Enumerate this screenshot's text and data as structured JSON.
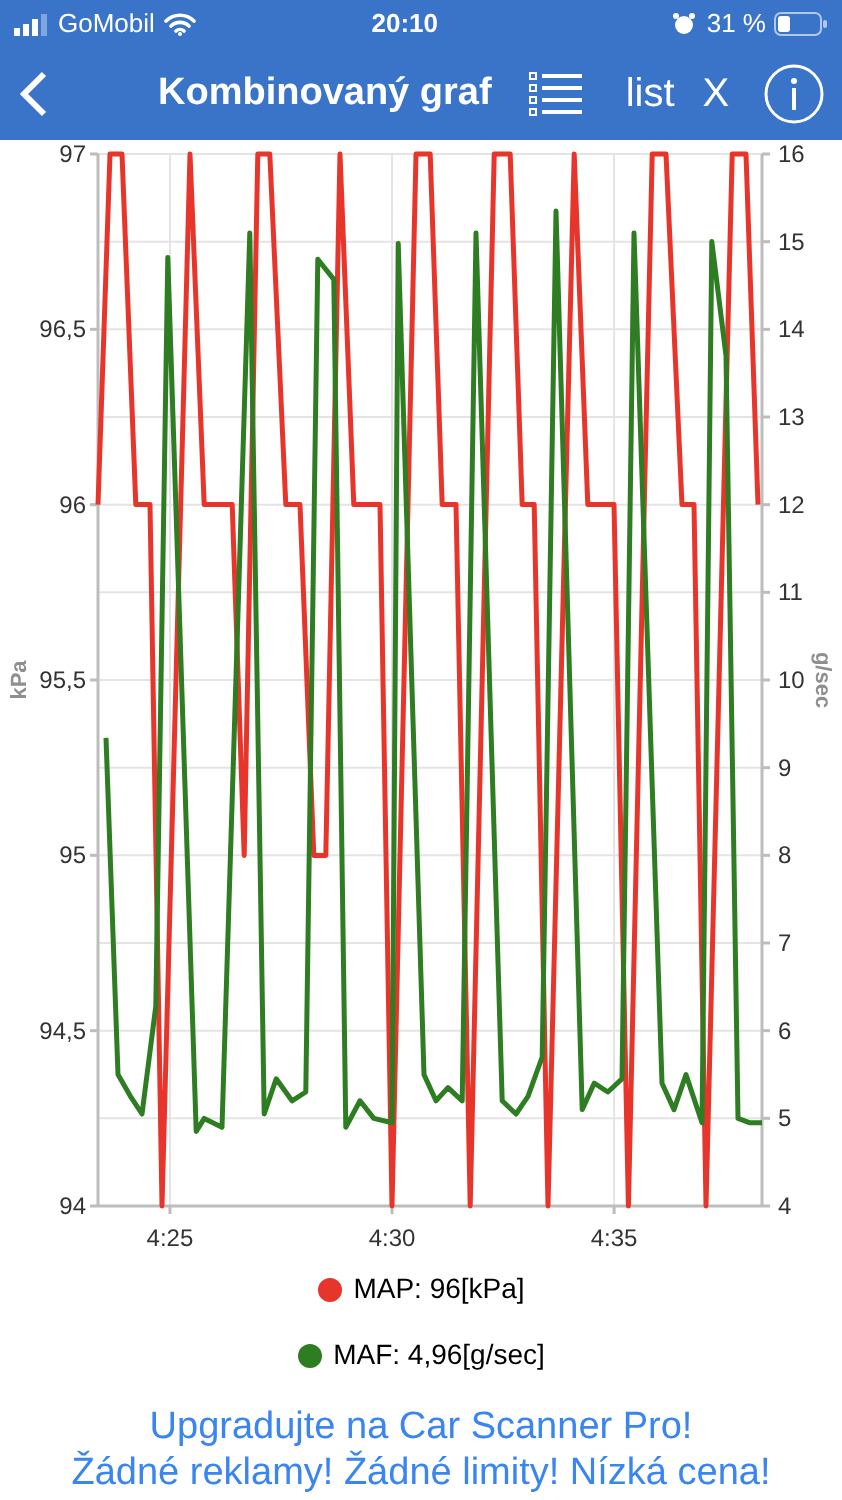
{
  "status_bar": {
    "carrier": "GoMobil",
    "time": "20:10",
    "battery": "31 %"
  },
  "nav": {
    "title": "Kombinovaný graf",
    "list_label": "list",
    "close_label": "X"
  },
  "chart_data": {
    "type": "line",
    "grid": true,
    "ylabel": "kPa",
    "y2label": "g/sec",
    "xlim": [
      263.38,
      278.33
    ],
    "ylim": [
      94,
      97
    ],
    "y2lim": [
      4,
      16
    ],
    "xticks": [
      {
        "value": 265,
        "label": "4:25"
      },
      {
        "value": 270,
        "label": "4:30"
      },
      {
        "value": 275,
        "label": "4:35"
      }
    ],
    "yticks": [
      {
        "value": 94,
        "label": "94"
      },
      {
        "value": 94.5,
        "label": "94,5"
      },
      {
        "value": 95,
        "label": "95"
      },
      {
        "value": 95.5,
        "label": "95,5"
      },
      {
        "value": 96,
        "label": "96"
      },
      {
        "value": 96.5,
        "label": "96,5"
      },
      {
        "value": 97,
        "label": "97"
      }
    ],
    "y2ticks": [
      4,
      5,
      6,
      7,
      8,
      9,
      10,
      11,
      12,
      13,
      14,
      15,
      16
    ],
    "series": [
      {
        "name": "MAP",
        "color": "#e8352b",
        "axis": "y",
        "x": [
          263.38,
          263.65,
          263.92,
          264.23,
          264.55,
          264.82,
          265.45,
          265.77,
          266.4,
          266.67,
          266.98,
          267.25,
          267.61,
          267.93,
          268.24,
          268.51,
          268.83,
          269.14,
          269.73,
          270.0,
          270.54,
          270.86,
          271.13,
          271.44,
          271.76,
          272.3,
          272.66,
          272.93,
          273.2,
          273.51,
          274.1,
          274.41,
          275.0,
          275.32,
          275.86,
          276.17,
          276.53,
          276.8,
          277.07,
          277.66,
          277.97,
          278.24
        ],
        "values": [
          96,
          97,
          97,
          96,
          96,
          94,
          97,
          96,
          96,
          95,
          97,
          97,
          96,
          96,
          95,
          95,
          97,
          96,
          96,
          94,
          97,
          97,
          96,
          96,
          94,
          97,
          97,
          96,
          96,
          94,
          97,
          96,
          96,
          94,
          97,
          97,
          96,
          96,
          94,
          97,
          97,
          96
        ]
      },
      {
        "name": "MAF",
        "color": "#2e7d22",
        "axis": "y2",
        "x": [
          263.56,
          263.83,
          264.1,
          264.37,
          264.68,
          264.95,
          265.59,
          265.77,
          266.17,
          266.8,
          267.12,
          267.39,
          267.75,
          268.06,
          268.33,
          268.69,
          268.96,
          269.28,
          269.59,
          270.0,
          270.14,
          270.72,
          270.99,
          271.26,
          271.58,
          271.89,
          272.48,
          272.79,
          273.06,
          273.38,
          273.69,
          274.28,
          274.55,
          274.86,
          275.18,
          275.45,
          276.08,
          276.35,
          276.62,
          276.98,
          277.2,
          277.52,
          277.79,
          278.06,
          278.33
        ],
        "values": [
          9.34,
          5.5,
          5.26,
          5.05,
          6.28,
          14.82,
          4.85,
          5.0,
          4.9,
          15.1,
          5.05,
          5.45,
          5.2,
          5.3,
          14.8,
          14.57,
          4.9,
          5.2,
          5.0,
          4.95,
          14.98,
          5.5,
          5.2,
          5.35,
          5.2,
          15.1,
          5.2,
          5.05,
          5.25,
          5.7,
          15.35,
          5.1,
          5.4,
          5.3,
          5.45,
          15.1,
          5.4,
          5.1,
          5.5,
          4.95,
          15.0,
          13.7,
          5.0,
          4.95,
          4.95
        ]
      }
    ]
  },
  "legend": [
    {
      "value": ": 96[kPa]"
    },
    {
      "value": ": 4,96[g/sec]"
    }
  ],
  "promo": [
    "Upgradujte na Car Scanner Pro!",
    "Žádné reklamy! Žádné limity! Nízká cena!"
  ]
}
